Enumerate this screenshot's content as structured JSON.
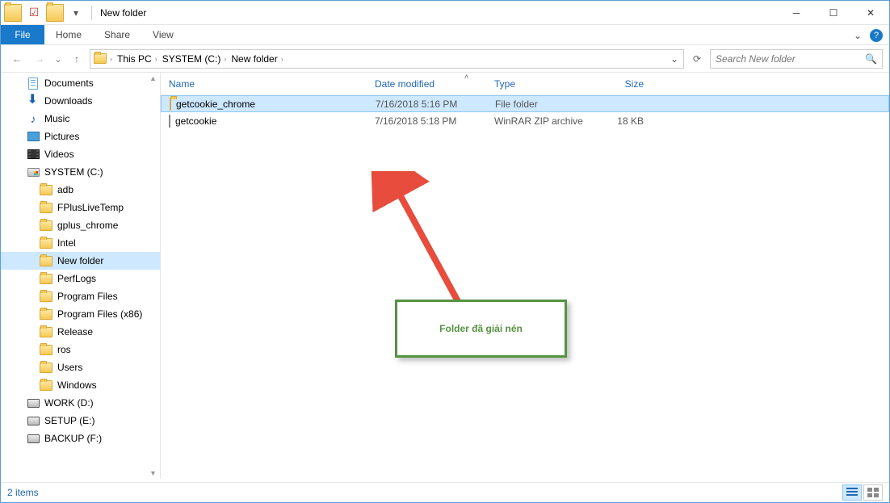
{
  "window": {
    "title": "New folder"
  },
  "ribbon": {
    "file": "File",
    "tabs": [
      "Home",
      "Share",
      "View"
    ]
  },
  "breadcrumbs": [
    "This PC",
    "SYSTEM (C:)",
    "New folder"
  ],
  "search": {
    "placeholder": "Search New folder"
  },
  "sidebar": {
    "items": [
      {
        "label": "Documents",
        "icon": "documents"
      },
      {
        "label": "Downloads",
        "icon": "downloads"
      },
      {
        "label": "Music",
        "icon": "music"
      },
      {
        "label": "Pictures",
        "icon": "pictures"
      },
      {
        "label": "Videos",
        "icon": "videos"
      },
      {
        "label": "SYSTEM (C:)",
        "icon": "drive-win"
      },
      {
        "label": "adb",
        "icon": "folder",
        "level": 2
      },
      {
        "label": "FPlusLiveTemp",
        "icon": "folder",
        "level": 2
      },
      {
        "label": "gplus_chrome",
        "icon": "folder",
        "level": 2
      },
      {
        "label": "Intel",
        "icon": "folder",
        "level": 2
      },
      {
        "label": "New folder",
        "icon": "folder",
        "level": 2,
        "selected": true
      },
      {
        "label": "PerfLogs",
        "icon": "folder",
        "level": 2
      },
      {
        "label": "Program Files",
        "icon": "folder",
        "level": 2
      },
      {
        "label": "Program Files (x86)",
        "icon": "folder",
        "level": 2
      },
      {
        "label": "Release",
        "icon": "folder",
        "level": 2
      },
      {
        "label": "ros",
        "icon": "folder",
        "level": 2
      },
      {
        "label": "Users",
        "icon": "folder",
        "level": 2
      },
      {
        "label": "Windows",
        "icon": "folder",
        "level": 2
      },
      {
        "label": "WORK (D:)",
        "icon": "drive"
      },
      {
        "label": "SETUP (E:)",
        "icon": "drive"
      },
      {
        "label": "BACKUP (F:)",
        "icon": "drive"
      }
    ]
  },
  "columns": {
    "name": "Name",
    "date": "Date modified",
    "type": "Type",
    "size": "Size"
  },
  "files": [
    {
      "name": "getcookie_chrome",
      "date": "7/16/2018 5:16 PM",
      "type": "File folder",
      "size": "",
      "icon": "folder",
      "selected": true
    },
    {
      "name": "getcookie",
      "date": "7/16/2018 5:18 PM",
      "type": "WinRAR ZIP archive",
      "size": "18 KB",
      "icon": "zip"
    }
  ],
  "status": {
    "count": "2 items"
  },
  "annotation": {
    "text": "Folder đã giải nén"
  }
}
